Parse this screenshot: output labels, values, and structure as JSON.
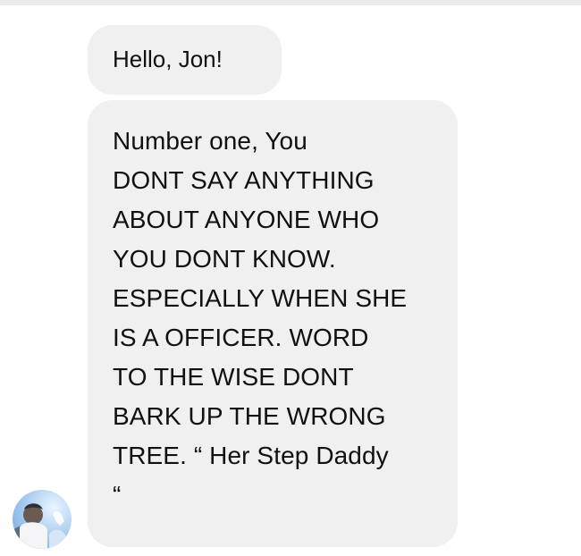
{
  "chat": {
    "messages": [
      {
        "text": "Hello, Jon!"
      },
      {
        "lines": [
          "Number one, You",
          "DONT SAY ANYTHING",
          "ABOUT ANYONE WHO",
          "YOU DONT KNOW.",
          "ESPECIALLY WHEN SHE",
          "IS A OFFICER. WORD",
          "TO THE WISE DONT",
          "BARK UP THE WRONG",
          "TREE. “ Her Step Daddy",
          "“"
        ]
      }
    ],
    "avatar_icon": "user-avatar"
  },
  "colors": {
    "bubble": "#f0f0f0",
    "text": "#111111",
    "top_border": "#ececec"
  }
}
